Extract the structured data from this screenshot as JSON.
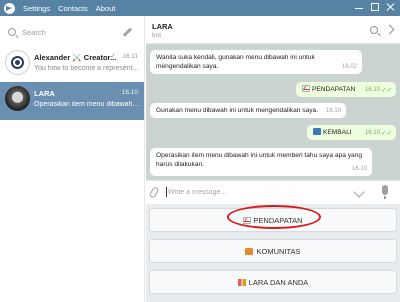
{
  "menu": [
    "Settings",
    "Contacts",
    "About"
  ],
  "sidebar": {
    "search_placeholder": "Search",
    "chats": [
      {
        "name": "Alexander ⚔️ Creator...",
        "time": "16.11",
        "preview": "You how to become a represent..."
      },
      {
        "name": "LARA",
        "time": "16.10",
        "preview": "Operasikan item menu dibawah ini u..."
      }
    ]
  },
  "chat": {
    "title": "LARA",
    "status": "bot",
    "composer_placeholder": "Write a message...",
    "messages": [
      {
        "direction": "in",
        "text": "Wanita suka kendali, gunakan menu dibawah ini untuk mengendalikan saya.",
        "time": "16.02"
      },
      {
        "direction": "out",
        "text": "PENDAPATAN",
        "time": "16.10",
        "icon": "chart-icon"
      },
      {
        "direction": "in",
        "text": "Gunakan menu dibawah ini untuk mengendalikan saya.",
        "time": "16.10"
      },
      {
        "direction": "out",
        "text": "KEMBALI",
        "time": "16.10",
        "icon": "back-arrow-icon"
      },
      {
        "direction": "in",
        "text": "Operasikan item menu dibawah ini untuk memberi tahu saya apa yang harus dilakukan.",
        "time": "16.10"
      }
    ]
  },
  "keyboard": {
    "buttons": [
      {
        "label": "PENDAPATAN",
        "icon": "chart-icon"
      },
      {
        "label": "KOMUNITAS",
        "icon": "community-icon"
      },
      {
        "label": "LARA DAN ANDA",
        "icon": "couple-icon"
      }
    ],
    "highlight_color": "#d41c1c"
  },
  "colors": {
    "titlebar": "#5682a3",
    "active_chat": "#6b8fb0",
    "chat_background": "#ccd4d1",
    "outgoing_bubble": "#eeffde"
  }
}
